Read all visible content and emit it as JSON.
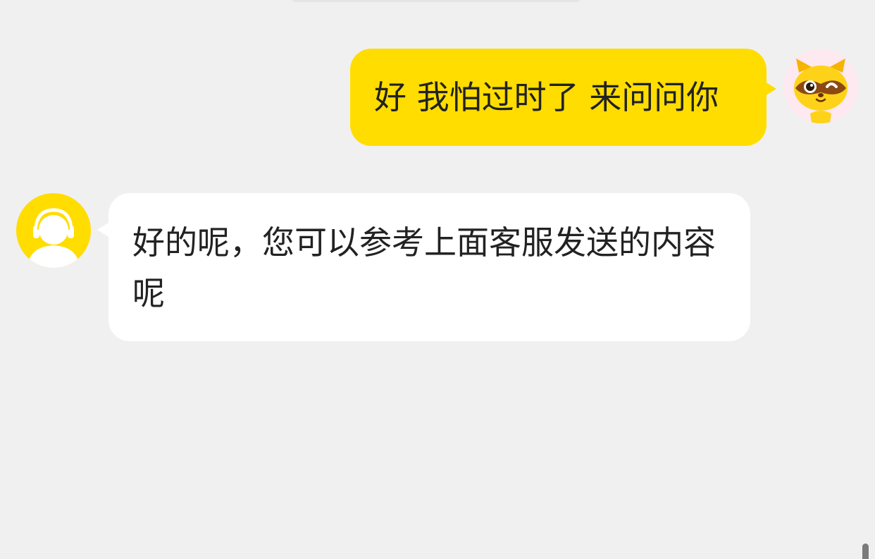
{
  "messages": [
    {
      "direction": "outgoing",
      "text": "好 我怕过时了 来问问你",
      "avatar": "raccoon-mascot-icon"
    },
    {
      "direction": "incoming",
      "text": "好的呢，您可以参考上面客服发送的内容呢",
      "avatar": "support-agent-headset-icon"
    }
  ],
  "colors": {
    "background": "#f0f0f0",
    "outgoing_bubble": "#ffdd00",
    "incoming_bubble": "#ffffff",
    "text": "#222222"
  }
}
